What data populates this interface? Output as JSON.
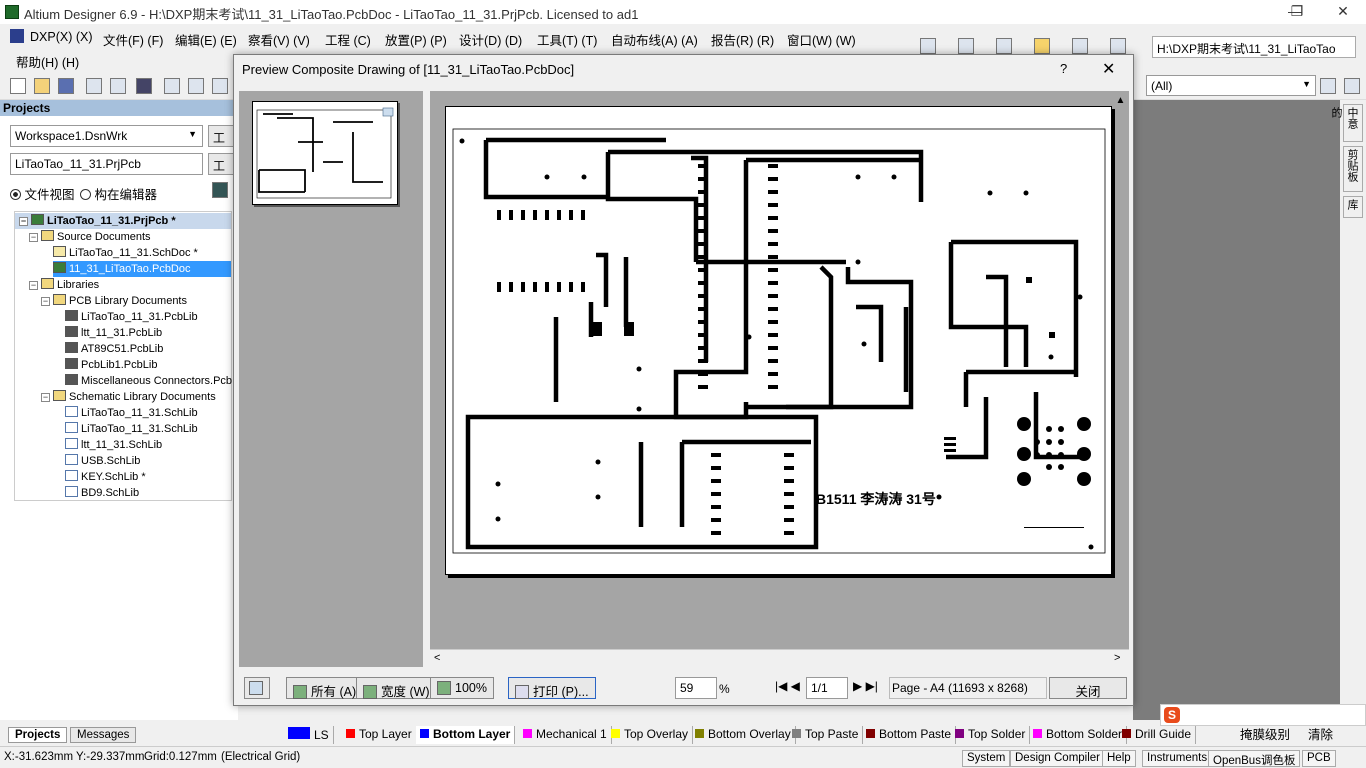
{
  "window": {
    "title": "Altium Designer 6.9 - H:\\DXP期末考试\\11_31_LiTaoTao.PcbDoc - LiTaoTao_11_31.PrjPcb. Licensed to ad1",
    "minimize": "—",
    "restore": "❐",
    "close": "✕"
  },
  "menu": {
    "items": [
      "DXP(X) (X)",
      "文件(F) (F)",
      "编辑(E) (E)",
      "察看(V) (V)",
      "工程 (C)",
      "放置(P) (P)",
      "设计(D) (D)",
      "工具(T) (T)",
      "自动布线(A) (A)",
      "报告(R) (R)",
      "窗口(W) (W)"
    ],
    "help": "帮助(H) (H)"
  },
  "toolbar": {
    "path_combo": "H:\\DXP期末考试\\11_31_LiTaoTao",
    "filter_combo": "(All)"
  },
  "projects_panel": {
    "header": "Projects",
    "workspace": "Workspace1.DsnWrk",
    "workspace_btn": "工",
    "project": "LiTaoTao_11_31.PrjPcb",
    "project_btn": "工",
    "radio_file_view": "文件视图",
    "radio_struct_editor": "构在编辑器",
    "tree": [
      {
        "label": "LiTaoTao_11_31.PrjPcb *",
        "level": 0,
        "bold": true,
        "selected_bg": true
      },
      {
        "label": "Source Documents",
        "level": 1
      },
      {
        "label": "LiTaoTao_11_31.SchDoc *",
        "level": 2
      },
      {
        "label": "11_31_LiTaoTao.PcbDoc",
        "level": 2,
        "highlight": true
      },
      {
        "label": "Libraries",
        "level": 1
      },
      {
        "label": "PCB Library Documents",
        "level": 2
      },
      {
        "label": "LiTaoTao_11_31.PcbLib",
        "level": 3
      },
      {
        "label": "ltt_11_31.PcbLib",
        "level": 3
      },
      {
        "label": "AT89C51.PcbLib",
        "level": 3
      },
      {
        "label": "PcbLib1.PcbLib",
        "level": 3
      },
      {
        "label": "Miscellaneous Connectors.Pcb",
        "level": 3
      },
      {
        "label": "Schematic Library Documents",
        "level": 2
      },
      {
        "label": "LiTaoTao_11_31.SchLib",
        "level": 3
      },
      {
        "label": "LiTaoTao_11_31.SchLib",
        "level": 3
      },
      {
        "label": "ltt_11_31.SchLib",
        "level": 3
      },
      {
        "label": "USB.SchLib",
        "level": 3
      },
      {
        "label": "KEY.SchLib *",
        "level": 3
      },
      {
        "label": "BD9.SchLib",
        "level": 3
      }
    ],
    "tabs": [
      "Projects",
      "Messages"
    ]
  },
  "dialog": {
    "title": "Preview Composite Drawing of [11_31_LiTaoTao.PcbDoc]",
    "help": "?",
    "close": "✕",
    "pcb_label": "B1511 李涛涛  31号",
    "buttons": {
      "all": "所有 (A)",
      "width": "宽度 (W)",
      "zoom100": "100%",
      "print": "打印 (P)..."
    },
    "zoom_value": "59",
    "zoom_unit": "%",
    "page_nav": "1/1",
    "page_info": "Page - A4 (11693 x 8268)",
    "close_btn": "关闭"
  },
  "layer_tabs": [
    {
      "label": "LS",
      "color": "#0000ff"
    },
    {
      "label": "Top Layer",
      "color": "#ff0000"
    },
    {
      "label": "Bottom Layer",
      "color": "#0000ff",
      "bold": true
    },
    {
      "label": "Mechanical 1",
      "color": "#ff00ff"
    },
    {
      "label": "Top Overlay",
      "color": "#ffff00"
    },
    {
      "label": "Bottom Overlay",
      "color": "#808000"
    },
    {
      "label": "Top Paste",
      "color": "#808080"
    },
    {
      "label": "Bottom Paste",
      "color": "#800000"
    },
    {
      "label": "Top Solder",
      "color": "#800080"
    },
    {
      "label": "Bottom Solder",
      "color": "#ff00ff"
    },
    {
      "label": "Drill Guide",
      "color": "#800000"
    }
  ],
  "right_strip": [
    "中意的",
    "剪贴板",
    "库"
  ],
  "status": {
    "coords": "X:-31.623mm Y:-29.337mm",
    "grid": "Grid:0.127mm",
    "grid_type": "(Electrical Grid)",
    "mask_level": "掩膜级别",
    "clear": "清除",
    "buttons": [
      "System",
      "Design Compiler",
      "Help",
      "Instruments",
      "OpenBus调色板",
      "PCB"
    ]
  }
}
